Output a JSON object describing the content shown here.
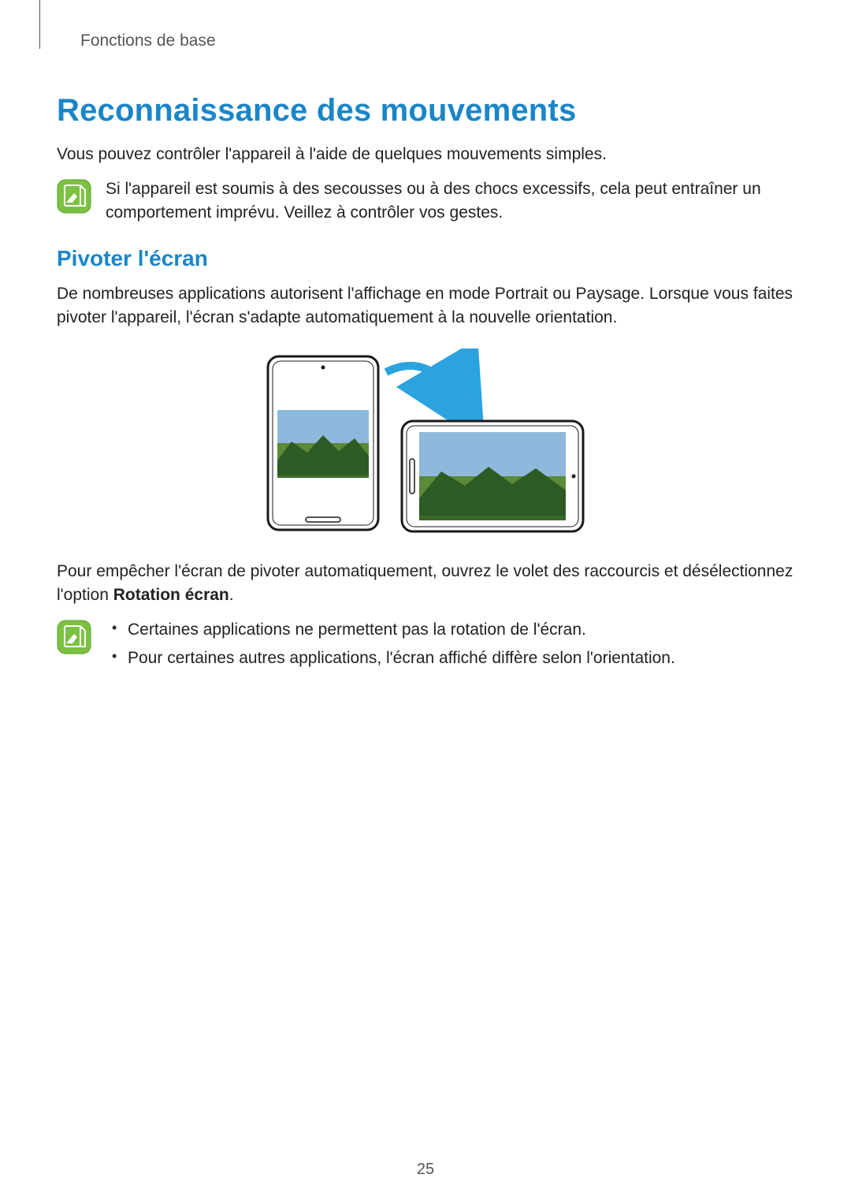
{
  "breadcrumb": "Fonctions de base",
  "title": "Reconnaissance des mouvements",
  "intro": "Vous pouvez contrôler l'appareil à l'aide de quelques mouvements simples.",
  "note1": "Si l'appareil est soumis à des secousses ou à des chocs excessifs, cela peut entraîner un comportement imprévu. Veillez à contrôler vos gestes.",
  "subtitle": "Pivoter l'écran",
  "para1": "De nombreuses applications autorisent l'affichage en mode Portrait ou Paysage. Lorsque vous faites pivoter l'appareil, l'écran s'adapte automatiquement à la nouvelle orientation.",
  "para2_a": "Pour empêcher l'écran de pivoter automatiquement, ouvrez le volet des raccourcis et désélectionnez l'option ",
  "para2_b": "Rotation écran",
  "para2_c": ".",
  "bullets": {
    "b1": "Certaines applications ne permettent pas la rotation de l'écran.",
    "b2": "Pour certaines autres applications, l'écran affiché diffère selon l'orientation."
  },
  "page_number": "25"
}
